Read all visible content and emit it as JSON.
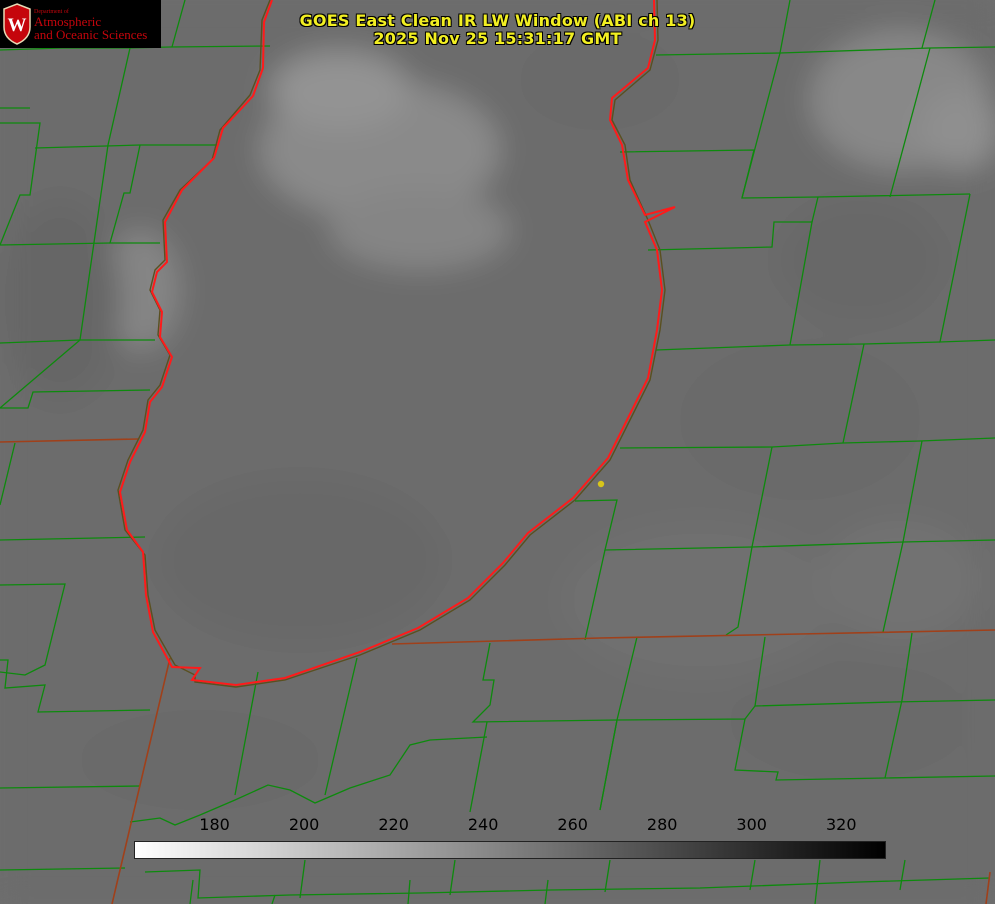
{
  "title": {
    "line1": "GOES East Clean IR LW Window (ABI ch 13)",
    "line2": "2025 Nov 25 15:31:17 GMT"
  },
  "logo": {
    "dept": "Department of",
    "line1": "Atmospheric",
    "line2": "and Oceanic Sciences",
    "crest_letter": "W"
  },
  "colorbar": {
    "min": 162,
    "max": 330,
    "ticks": [
      180,
      200,
      220,
      240,
      260,
      280,
      300,
      320
    ],
    "gradient": [
      "#ffffff",
      "#000000"
    ]
  },
  "colors": {
    "background": "#6e6e6e",
    "county_lines": "#0d8a0d",
    "state_lines": "#a0401a",
    "shoreline": "#ff1a1a",
    "title": "#f2ef22",
    "logo_red": "#c5050c"
  },
  "legend": {
    "type": "continuous-colorbar",
    "placement": "bottom"
  }
}
